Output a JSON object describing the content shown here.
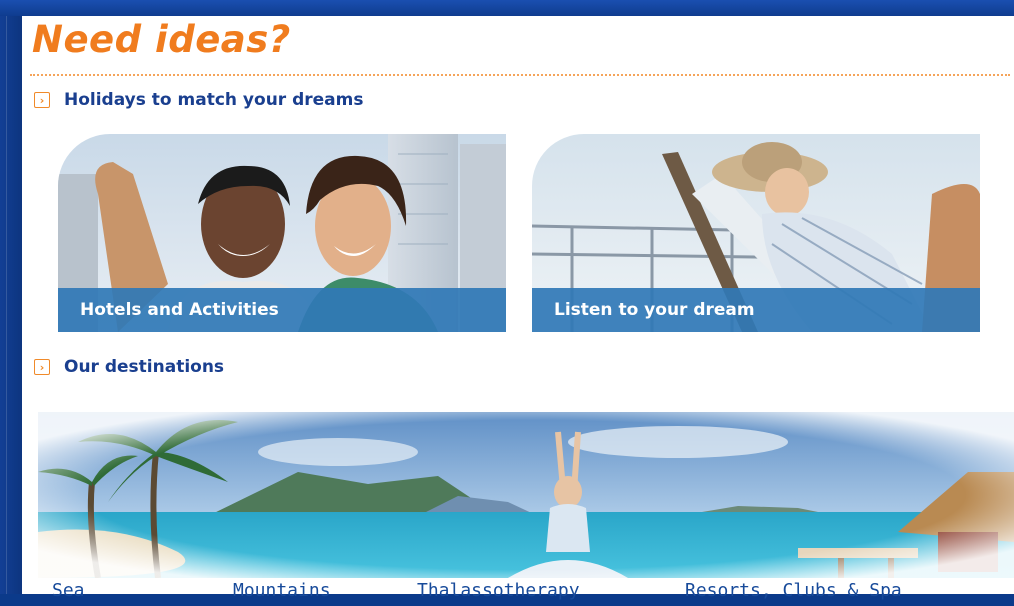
{
  "page": {
    "title": "Need ideas?"
  },
  "sections": [
    {
      "label": "Holidays to match your dreams"
    },
    {
      "label": "Our destinations"
    }
  ],
  "cards": [
    {
      "caption": "Hotels and Activities"
    },
    {
      "caption": "Listen to your dream"
    }
  ],
  "destinations": [
    {
      "label": "Sea"
    },
    {
      "label": "Mountains"
    },
    {
      "label": "Thalassotherapy"
    },
    {
      "label": "Resorts, Clubs & Spa"
    }
  ],
  "colors": {
    "title_orange": "#f07c1e",
    "heading_blue": "#1a3f8f",
    "caption_bar": "#3078b6",
    "frame_blue": "#0b3a8a"
  },
  "icons": {
    "section_bullet": "arrow-box-icon"
  }
}
